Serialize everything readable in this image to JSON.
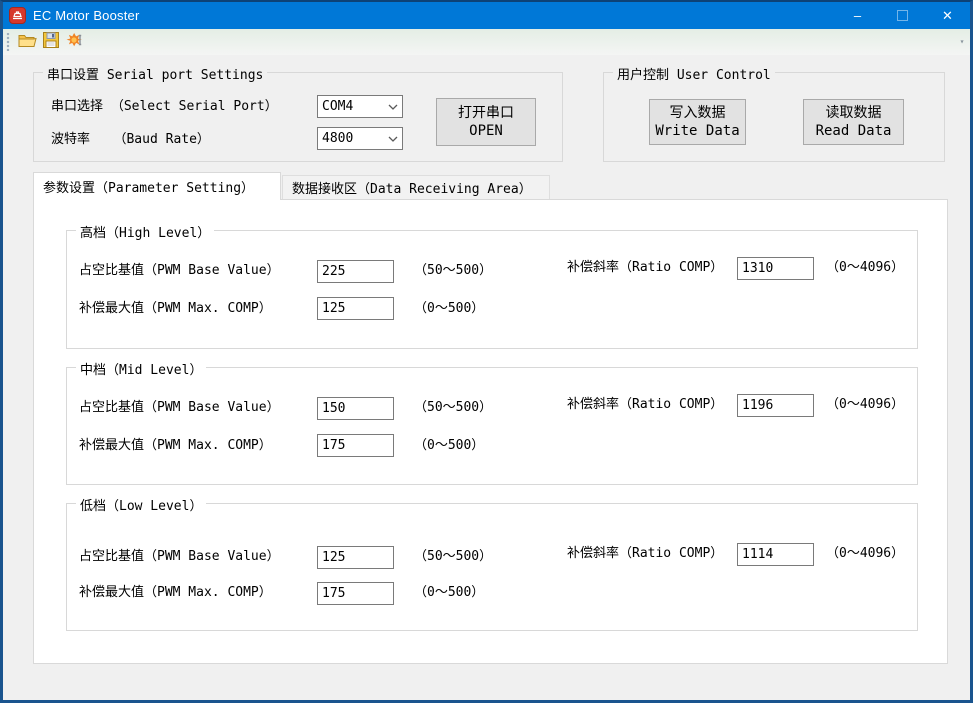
{
  "titlebar": {
    "title": "EC Motor Booster",
    "minimize_glyph": "–",
    "close_glyph": "✕",
    "maximize_enabled": false
  },
  "toolbar": {
    "icons": [
      "open-folder-icon",
      "save-icon",
      "tools-icon"
    ]
  },
  "serial": {
    "group_title": "串口设置 Serial port Settings",
    "port_label": "串口选择 （Select Serial Port）",
    "port_value": "COM4",
    "baud_label": "波特率   （Baud Rate）",
    "baud_value": "4800",
    "open_line1": "打开串口",
    "open_line2": "OPEN"
  },
  "user_control": {
    "group_title": "用户控制 User Control",
    "write_line1": "写入数据",
    "write_line2": "Write Data",
    "read_line1": "读取数据",
    "read_line2": "Read Data"
  },
  "tabs": {
    "parameter": "参数设置（Parameter Setting）",
    "receiving": "数据接收区（Data Receiving Area）"
  },
  "levels": [
    {
      "title": "高档（High Level）",
      "base_label": "占空比基值（PWM Base Value）",
      "base_value": "225",
      "base_range": "（50～500）",
      "ratio_label": "补偿斜率（Ratio COMP）",
      "ratio_value": "1310",
      "ratio_range": "（0～4096）",
      "max_label": "补偿最大值（PWM Max. COMP）",
      "max_value": "125",
      "max_range": "（0～500）"
    },
    {
      "title": "中档（Mid Level）",
      "base_label": "占空比基值（PWM Base Value）",
      "base_value": "150",
      "base_range": "（50～500）",
      "ratio_label": "补偿斜率（Ratio COMP）",
      "ratio_value": "1196",
      "ratio_range": "（0～4096）",
      "max_label": "补偿最大值（PWM Max. COMP）",
      "max_value": "175",
      "max_range": "（0～500）"
    },
    {
      "title": "低档（Low Level）",
      "base_label": "占空比基值（PWM Base Value）",
      "base_value": "125",
      "base_range": "（50～500）",
      "ratio_label": "补偿斜率（Ratio COMP）",
      "ratio_value": "1114",
      "ratio_range": "（0～4096）",
      "max_label": "补偿最大值（PWM Max. COMP）",
      "max_value": "175",
      "max_range": "（0～500）"
    }
  ],
  "colors": {
    "titlebar": "#0078d7",
    "window_border": "#1a548e",
    "dialog_bg": "#f0f0f0",
    "button_bg": "#e2e2e2"
  }
}
